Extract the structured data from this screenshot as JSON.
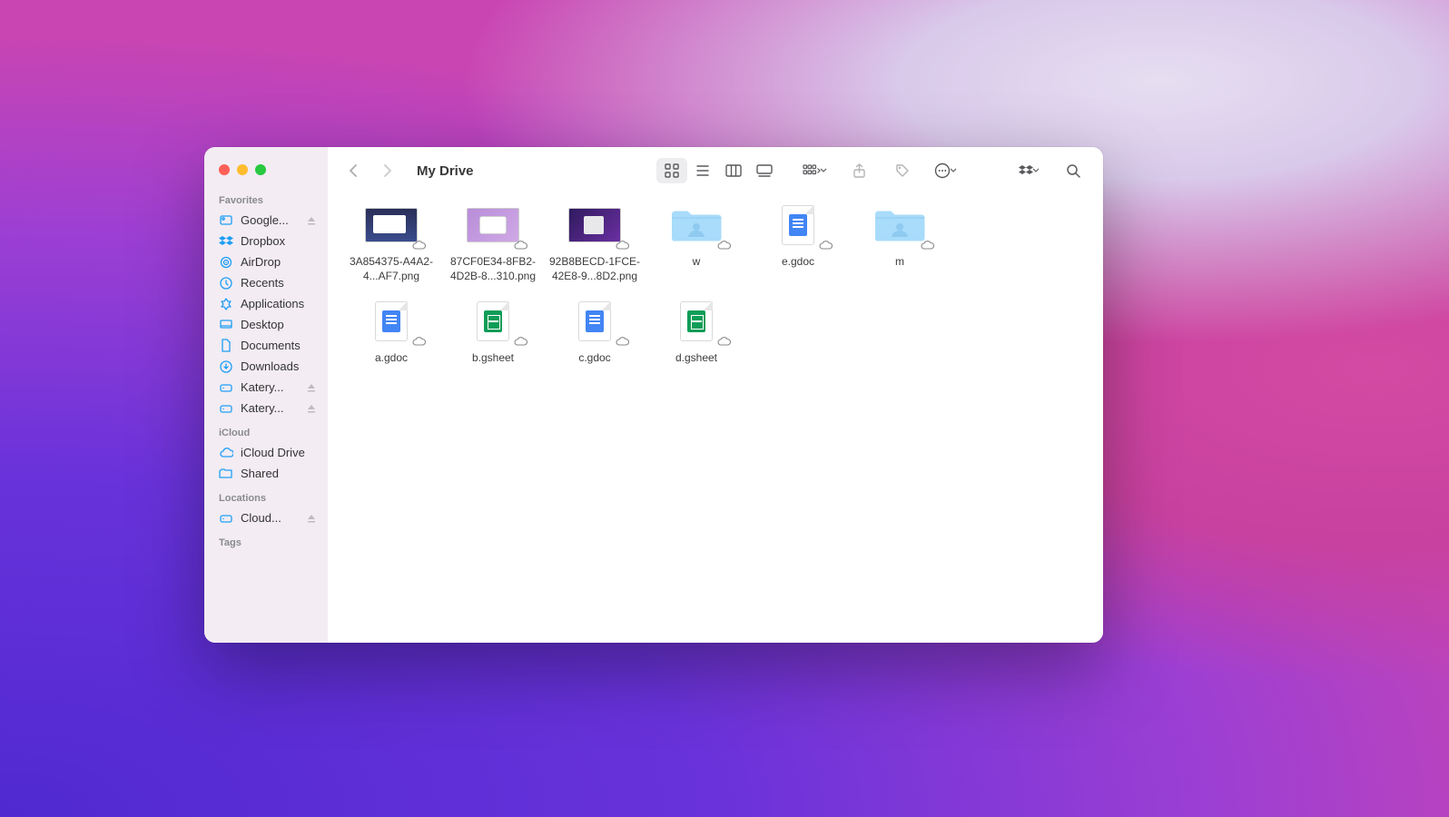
{
  "window": {
    "title": "My Drive"
  },
  "sidebar": {
    "sections": {
      "favorites": {
        "header": "Favorites",
        "items": [
          {
            "label": "Google...",
            "icon": "gdrive",
            "ejectable": true
          },
          {
            "label": "Dropbox",
            "icon": "dropbox",
            "ejectable": false
          },
          {
            "label": "AirDrop",
            "icon": "airdrop",
            "ejectable": false
          },
          {
            "label": "Recents",
            "icon": "recent",
            "ejectable": false
          },
          {
            "label": "Applications",
            "icon": "apps",
            "ejectable": false
          },
          {
            "label": "Desktop",
            "icon": "desktop",
            "ejectable": false
          },
          {
            "label": "Documents",
            "icon": "document",
            "ejectable": false
          },
          {
            "label": "Downloads",
            "icon": "downloads",
            "ejectable": false
          },
          {
            "label": "Katery...",
            "icon": "disk",
            "ejectable": true
          },
          {
            "label": "Katery...",
            "icon": "disk",
            "ejectable": true
          }
        ]
      },
      "icloud": {
        "header": "iCloud",
        "items": [
          {
            "label": "iCloud Drive",
            "icon": "cloud",
            "ejectable": false
          },
          {
            "label": "Shared",
            "icon": "shared",
            "ejectable": false
          }
        ]
      },
      "locations": {
        "header": "Locations",
        "items": [
          {
            "label": "Cloud...",
            "icon": "disk",
            "ejectable": true
          }
        ]
      },
      "tags": {
        "header": "Tags"
      }
    }
  },
  "files": [
    {
      "name": "3A854375-A4A2-4...AF7.png",
      "kind": "png",
      "variant": "p1",
      "cloud": true
    },
    {
      "name": "87CF0E34-8FB2-4D2B-8...310.png",
      "kind": "png",
      "variant": "p2",
      "cloud": true
    },
    {
      "name": "92B8BECD-1FCE-42E8-9...8D2.png",
      "kind": "png",
      "variant": "p3",
      "cloud": true
    },
    {
      "name": "w",
      "kind": "folder",
      "cloud": true
    },
    {
      "name": "e.gdoc",
      "kind": "gdoc",
      "cloud": true
    },
    {
      "name": "m",
      "kind": "folder",
      "cloud": true
    },
    {
      "name": "a.gdoc",
      "kind": "gdoc",
      "cloud": true
    },
    {
      "name": "b.gsheet",
      "kind": "gsheet",
      "cloud": true
    },
    {
      "name": "c.gdoc",
      "kind": "gdoc",
      "cloud": true
    },
    {
      "name": "d.gsheet",
      "kind": "gsheet",
      "cloud": true
    }
  ]
}
